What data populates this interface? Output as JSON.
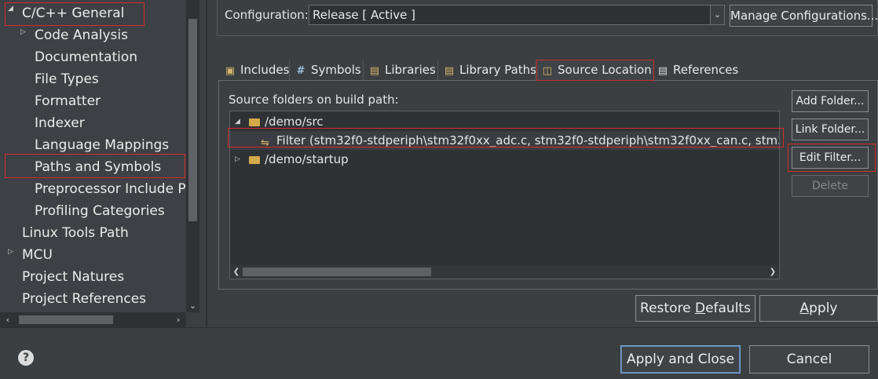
{
  "tree": {
    "items": [
      {
        "label": "C/C++ General",
        "level": 0,
        "expanded": true
      },
      {
        "label": "Code Analysis",
        "level": 1,
        "collapsed": true
      },
      {
        "label": "Documentation",
        "level": 1
      },
      {
        "label": "File Types",
        "level": 1
      },
      {
        "label": "Formatter",
        "level": 1
      },
      {
        "label": "Indexer",
        "level": 1
      },
      {
        "label": "Language Mappings",
        "level": 1
      },
      {
        "label": "Paths and Symbols",
        "level": 1,
        "selected": true
      },
      {
        "label": "Preprocessor Include P",
        "level": 1
      },
      {
        "label": "Profiling Categories",
        "level": 1
      },
      {
        "label": "Linux Tools Path",
        "level": 0
      },
      {
        "label": "MCU",
        "level": 0,
        "collapsed": true
      },
      {
        "label": "Project Natures",
        "level": 0
      },
      {
        "label": "Project References",
        "level": 0
      }
    ]
  },
  "config": {
    "label": "Configuration:",
    "value": "Release  [ Active ]",
    "manage_button": "Manage Configurations..."
  },
  "tabs": [
    {
      "label": "Includes",
      "icon": "includes-icon"
    },
    {
      "label": "Symbols",
      "icon": "hash-icon"
    },
    {
      "label": "Libraries",
      "icon": "library-icon"
    },
    {
      "label": "Library Paths",
      "icon": "library-path-icon"
    },
    {
      "label": "Source Location",
      "icon": "source-folder-icon",
      "active": true
    },
    {
      "label": "References",
      "icon": "references-icon"
    }
  ],
  "source": {
    "label": "Source folders on build path:",
    "rows": [
      {
        "label": "/demo/src",
        "type": "folder",
        "expanded": true
      },
      {
        "label": "Filter (stm32f0-stdperiph\\stm32f0xx_adc.c, stm32f0-stdperiph\\stm32f0xx_can.c, stm32f0-std",
        "type": "filter"
      },
      {
        "label": "/demo/startup",
        "type": "folder",
        "collapsed": true
      }
    ]
  },
  "side_buttons": {
    "add_folder": "Add Folder...",
    "link_folder": "Link Folder...",
    "edit_filter": "Edit Filter...",
    "delete": "Delete"
  },
  "actions": {
    "restore_defaults_pre": "Restore ",
    "restore_defaults_u": "D",
    "restore_defaults_post": "efaults",
    "apply_u": "A",
    "apply_post": "pply",
    "apply_close": "Apply and Close",
    "cancel": "Cancel"
  },
  "colors": {
    "highlight": "#d22b2b",
    "folder": "#d6a94a"
  }
}
